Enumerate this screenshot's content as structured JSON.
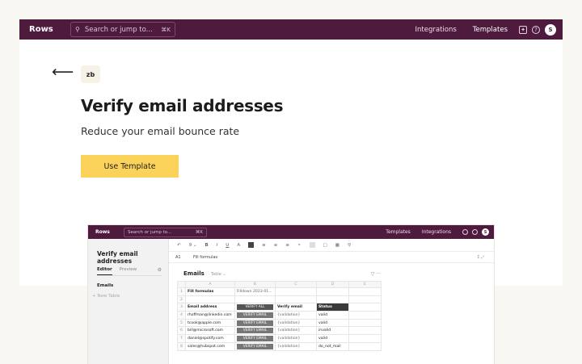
{
  "topbar": {
    "brand": "Rows",
    "search_placeholder": "Search or jump to...",
    "search_shortcut": "⌘K",
    "nav": [
      "Integrations",
      "Templates"
    ],
    "avatar": "S"
  },
  "hero": {
    "back_arrow": "⟵",
    "publisher_badge": "zb",
    "title": "Verify email addresses",
    "subtitle": "Reduce your email bounce rate",
    "cta_label": "Use Template",
    "cta_color": "#fbd25a"
  },
  "preview": {
    "topbar": {
      "brand": "Rows",
      "search_placeholder": "Search or jump to...",
      "search_shortcut": "⌘K",
      "nav": [
        "Templates",
        "Integrations"
      ],
      "avatar": "S"
    },
    "sidebar": {
      "title": "Verify email addresses",
      "tabs": [
        "Editor",
        "Preview"
      ],
      "tables": [
        "Emails"
      ],
      "new_table": "+ New Table"
    },
    "formula_bar": {
      "cell_ref": "A1",
      "value": "Fill formulas"
    },
    "table": {
      "name": "Emails",
      "type": "· Table ⌄",
      "columns": [
        "",
        "A",
        "B",
        "C",
        "D",
        "E"
      ],
      "rows": [
        {
          "n": "1",
          "cells": [
            "Fill formulas",
            "Filldown 2023-01...",
            "",
            "",
            ""
          ]
        },
        {
          "n": "2",
          "cells": [
            "",
            "",
            "",
            "",
            ""
          ]
        },
        {
          "n": "3",
          "cells": [
            "Email address",
            "VERIFY ALL",
            "Verify email",
            "Status",
            ""
          ]
        },
        {
          "n": "4",
          "cells": [
            "rhoffman@linkedin.com",
            "VERIFY EMAIL",
            "{validation}",
            "valid",
            ""
          ]
        },
        {
          "n": "5",
          "cells": [
            "tcook@apple.com",
            "VERIFY EMAIL",
            "{validation}",
            "valid",
            ""
          ]
        },
        {
          "n": "6",
          "cells": [
            "bill@microsoft.com",
            "VERIFY EMAIL",
            "{validation}",
            "invalid",
            ""
          ]
        },
        {
          "n": "7",
          "cells": [
            "daniel@spotify.com",
            "VERIFY EMAIL",
            "{validation}",
            "valid",
            ""
          ]
        },
        {
          "n": "8",
          "cells": [
            "sales@hubspot.com",
            "VERIFY EMAIL",
            "{validation}",
            "do_not_mail",
            ""
          ]
        }
      ]
    }
  },
  "colors": {
    "brand_bar": "#4e1b3e",
    "page_bg": "#f9f7f1",
    "accent_button": "#fbd25a"
  }
}
